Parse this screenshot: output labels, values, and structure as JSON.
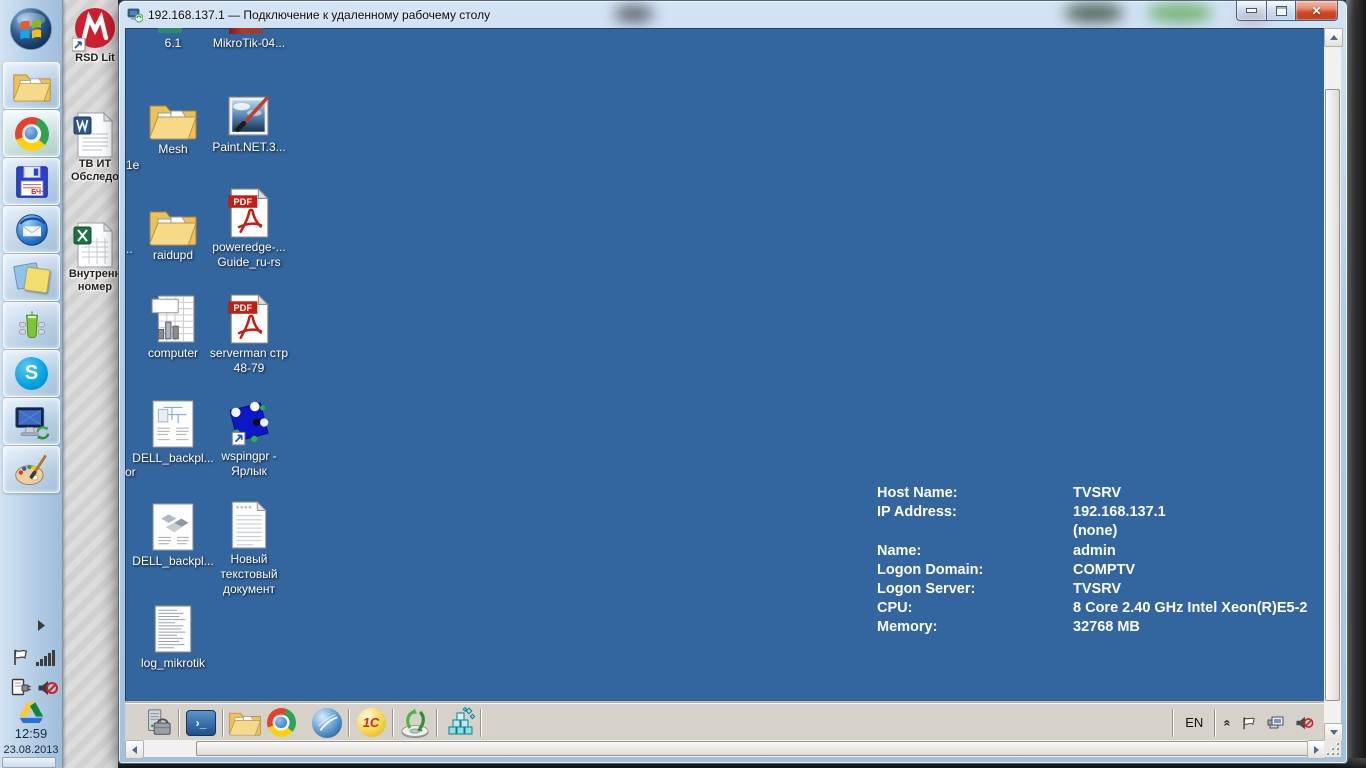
{
  "window": {
    "title": "192.168.137.1 — Подключение к удаленному рабочему столу",
    "controls": {
      "minimize": "–",
      "restore": "",
      "close": "✕"
    }
  },
  "host": {
    "desktop_icons": [
      {
        "icon": "rsd-lite-shortcut",
        "label": "RSD Lit"
      },
      {
        "icon": "word-document",
        "label": "ТВ ИТ\nОбследо"
      },
      {
        "icon": "excel-document",
        "label": "Внутренн\nномер"
      }
    ],
    "taskbar": {
      "buttons": [
        "start-orb",
        "windows-explorer",
        "google-chrome",
        "floppy-bch",
        "thunderbird",
        "sticky-notes",
        "qip",
        "skype",
        "remote-desktop",
        "paint"
      ],
      "tray_icons": [
        "expand-arrow",
        "action-center-flag",
        "network-signal",
        "power-plug",
        "volume-muted",
        "google-drive"
      ],
      "clock": {
        "time": "12:59",
        "date": "23.08.2013"
      }
    }
  },
  "remote": {
    "icons": [
      {
        "type": "clipped",
        "label": "6.1"
      },
      {
        "type": "clipped",
        "label": "MikroTik-04..."
      },
      {
        "type": "folder",
        "label": "Mesh"
      },
      {
        "type": "paintnet",
        "label": "Paint.NET.3..."
      },
      {
        "type": "folder",
        "label": "raidupd"
      },
      {
        "type": "pdf",
        "label": "poweredge-...\nGuide_ru-rs"
      },
      {
        "type": "spreadsheet",
        "label": "computer"
      },
      {
        "type": "pdf",
        "label": "serverman стр\n48-79"
      },
      {
        "type": "diagram",
        "label": "DELL_backpl..."
      },
      {
        "type": "shortcut-app",
        "label": "wspingpr -\nЯрлык"
      },
      {
        "type": "diagram",
        "label": "DELL_backpl..."
      },
      {
        "type": "text-document",
        "label": "Новый\nтекстовый\nдокумент"
      },
      {
        "type": "log-file",
        "label": "log_mikrotik"
      }
    ],
    "edge_label_fragments": [
      "1e",
      "..",
      "or"
    ],
    "bginfo": {
      "rows": [
        {
          "label": "Host Name:",
          "value": "TVSRV"
        },
        {
          "label": "IP Address:",
          "value": "192.168.137.1"
        },
        {
          "label": "",
          "value": "(none)"
        },
        {
          "label": "Name:",
          "value": "admin"
        },
        {
          "label": "Logon Domain:",
          "value": "COMPTV"
        },
        {
          "label": "Logon Server:",
          "value": "TVSRV"
        },
        {
          "label": "CPU:",
          "value": "8 Core 2.40 GHz Intel Xeon(R)E5-2"
        },
        {
          "label": "Memory:",
          "value": "32768 MB"
        }
      ]
    },
    "taskbar": {
      "quick_launch": [
        "server-manager",
        "powershell",
        "windows-explorer",
        "google-chrome",
        "winbox",
        "1c-enterprise",
        "driver-installer",
        "crystal-cubes"
      ],
      "onec_glyph": "1С",
      "tray": {
        "language": "EN",
        "icons": [
          "show-hidden-chevron",
          "action-center-flag",
          "network-plug",
          "volume-muted"
        ]
      }
    }
  },
  "colors": {
    "remote_desktop": "#33659E",
    "remote_taskbar": "#d6d2c9",
    "glass": "#b3cde8",
    "close_button": "#ce4a28"
  }
}
